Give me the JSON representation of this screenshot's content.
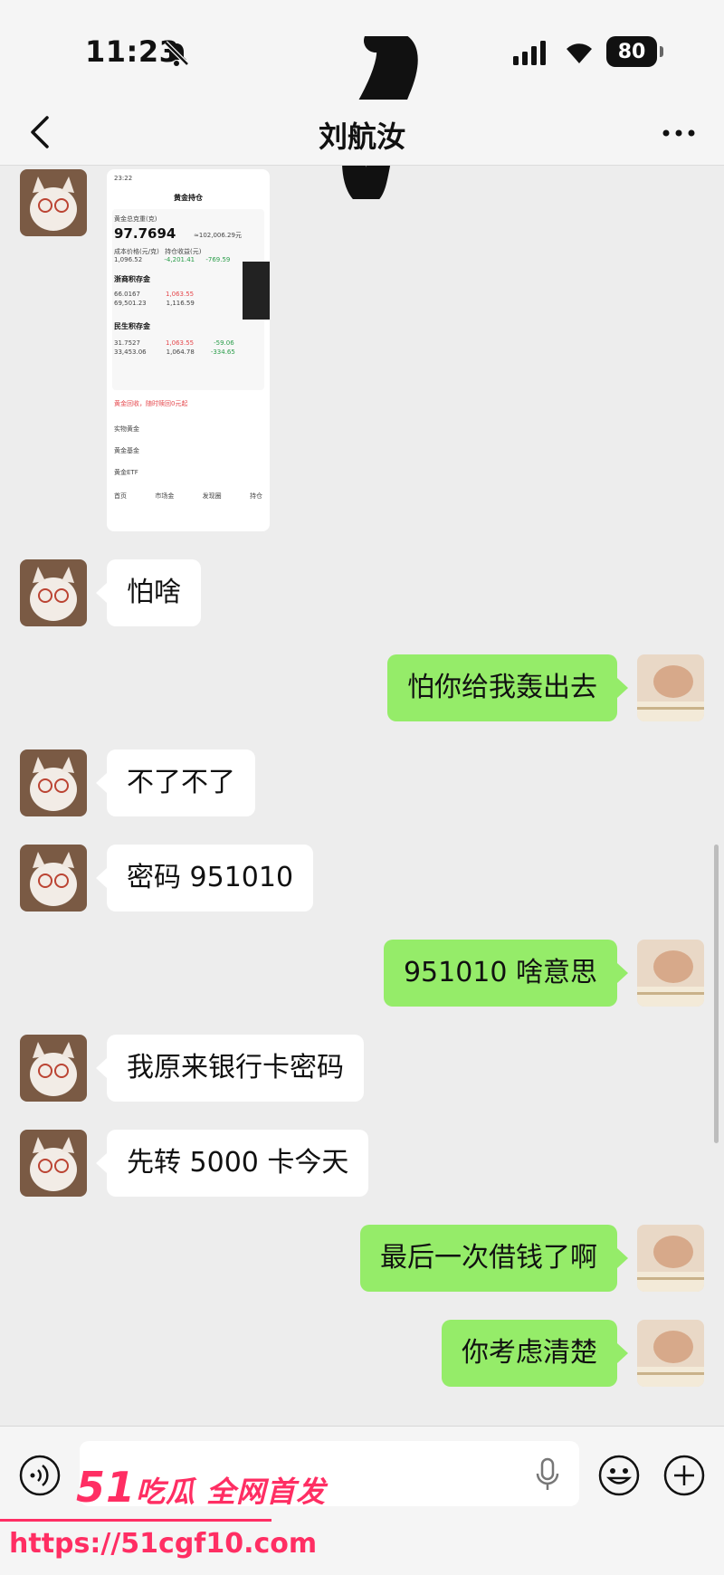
{
  "status_bar": {
    "time": "11:23",
    "battery": "80"
  },
  "header": {
    "contact_name": "刘航汝"
  },
  "shared_screenshot": {
    "time": "23:22",
    "page_title": "黄金持仓",
    "total_label": "黄金总克重(克)",
    "total_value": "97.7694",
    "total_sub": "≈102,006.29元",
    "stat_labels": [
      "成本价格(元/克)",
      "持仓收益(元)",
      "累计收益(元)"
    ],
    "stat_values": [
      "1,096.52",
      "-4,201.41",
      "-769.59"
    ],
    "section1_title": "浙商积存金",
    "section1_rows": [
      [
        "66.0167",
        "1,063.55",
        "-4,1"
      ],
      [
        "69,501.23",
        "1,116.59",
        "-4"
      ]
    ],
    "section2_title": "民生积存金",
    "section2_rows": [
      [
        "31.7527",
        "1,063.55",
        "-59.06"
      ],
      [
        "33,453.06",
        "1,064.78",
        "-334.65"
      ]
    ],
    "tip": "黄金回收，随时赎回0元起",
    "list_items": [
      "实物黄金",
      "黄金基金",
      "黄金ETF"
    ],
    "tabs": [
      "首页",
      "市场金",
      "发现圈",
      "持仓"
    ]
  },
  "messages": [
    {
      "side": "in",
      "text": "怕啥"
    },
    {
      "side": "out",
      "text": "怕你给我轰出去"
    },
    {
      "side": "in",
      "text": "不了不了"
    },
    {
      "side": "in",
      "text": "密码 951010"
    },
    {
      "side": "out",
      "text": "951010 啥意思"
    },
    {
      "side": "in",
      "text": "我原来银行卡密码"
    },
    {
      "side": "in",
      "text": "先转 5000 卡今天"
    },
    {
      "side": "out",
      "text": "最后一次借钱了啊"
    },
    {
      "side": "out",
      "text": "你考虑清楚"
    }
  ],
  "watermark": {
    "brand_num": "51",
    "brand_text": "吃瓜 全网首发",
    "url": "https://51cgf10.com"
  },
  "icons": {
    "back": "chevron-left-icon",
    "more": "more-dots-icon",
    "voice": "voice-icon",
    "mic": "mic-icon",
    "emoji": "emoji-icon",
    "plus": "plus-circle-icon"
  },
  "colors": {
    "outgoing_bubble": "#95ec69",
    "incoming_bubble": "#ffffff",
    "background": "#ededed",
    "watermark": "#ff2e63"
  }
}
